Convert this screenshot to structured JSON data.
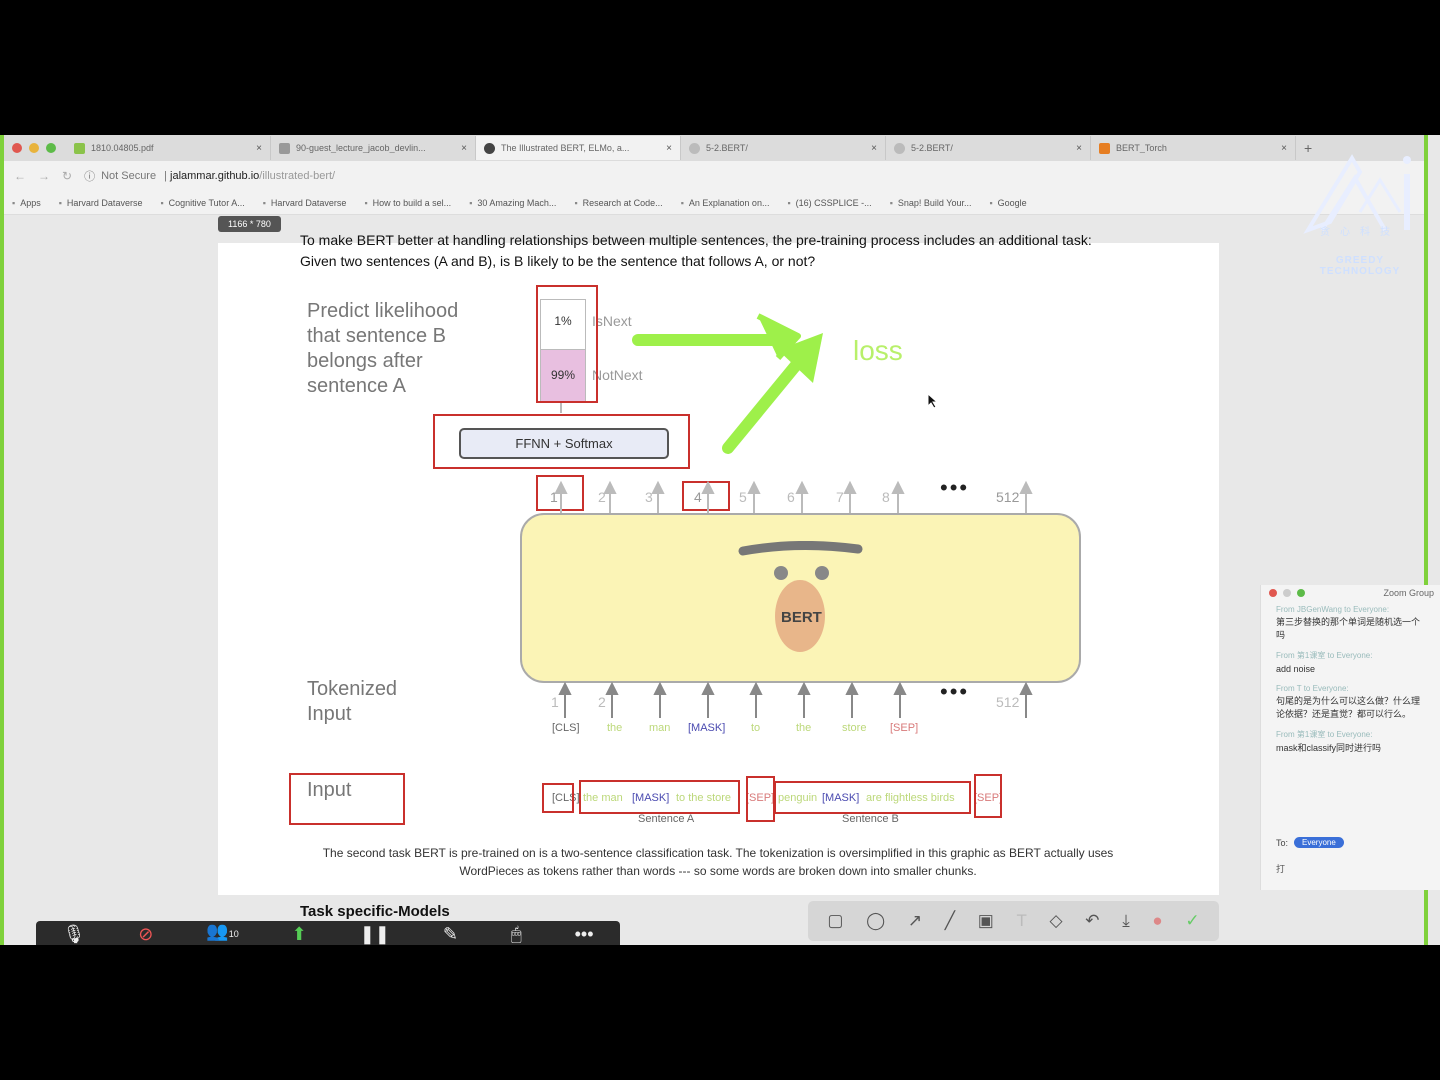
{
  "browser": {
    "tabs": [
      {
        "label": "1810.04805.pdf",
        "active": false
      },
      {
        "label": "90-guest_lecture_jacob_devlin...",
        "active": false
      },
      {
        "label": "The Illustrated BERT, ELMo, a...",
        "active": true
      },
      {
        "label": "5-2.BERT/",
        "active": false
      },
      {
        "label": "5-2.BERT/",
        "active": false
      },
      {
        "label": "BERT_Torch",
        "active": false
      }
    ],
    "security": "Not Secure",
    "url_domain": "jalammar.github.io",
    "url_path": "/illustrated-bert/",
    "bookmarks": [
      "Apps",
      "Harvard Dataverse",
      "Cognitive Tutor A...",
      "Harvard Dataverse",
      "How to build a sel...",
      "30 Amazing Mach...",
      "Research at Code...",
      "An Explanation on...",
      "(16) CSSPLICE -...",
      "Snap! Build Your...",
      "Google"
    ],
    "size_badge": "1166 * 780"
  },
  "page": {
    "intro_text": "To make BERT better at handling relationships between multiple sentences, the pre-training process includes an additional task: Given two sentences (A and B), is B likely to be the sentence that follows A, or not?",
    "predict_label": [
      "Predict likelihood",
      "that sentence B",
      "belongs after",
      "sentence A"
    ],
    "prob_isnext": "1%",
    "label_isnext": "IsNext",
    "prob_notnext": "99%",
    "label_notnext": "NotNext",
    "ffnn_label": "FFNN + Softmax",
    "loss_label": "loss",
    "bert_label": "BERT",
    "output_positions": [
      "1",
      "2",
      "3",
      "4",
      "5",
      "6",
      "7",
      "8",
      "512"
    ],
    "input_positions": [
      "1",
      "2",
      "512"
    ],
    "ellipsis": "•••",
    "tokenized_label": [
      "Tokenized",
      "Input"
    ],
    "tokens": [
      "[CLS]",
      "the",
      "man",
      "[MASK]",
      "to",
      "the",
      "store",
      "[SEP]"
    ],
    "input_label": "Input",
    "input_tokens": {
      "cls": "[CLS]",
      "sentence_a_pre": "the man",
      "sentence_a_mask": "[MASK]",
      "sentence_a_post": "to the store",
      "sep1": "[SEP]",
      "sentence_b_pre": "penguin",
      "sentence_b_mask": "[MASK]",
      "sentence_b_post": "are flightless birds",
      "sep2": "[SEP]"
    },
    "sentence_a_caption": "Sentence A",
    "sentence_b_caption": "Sentence B",
    "caption": "The second task BERT is pre-trained on is a two-sentence classification task. The tokenization is oversimplified in this graphic as BERT actually uses WordPieces as tokens rather than words --- so some words are broken down into smaller chunks.",
    "next_heading": "Task specific-Models"
  },
  "zoom": {
    "participants_count": "10",
    "chat_title": "Zoom Group",
    "messages": [
      {
        "from": "From JBGenWang to Everyone:",
        "body": "第三步替换的那个单词是随机选一个吗"
      },
      {
        "from": "From 第1课室 to Everyone:",
        "body": "add noise"
      },
      {
        "from": "From T to Everyone:",
        "body": "句尾的是为什么可以这么做？什么理论依据？还是直觉？都可以行么。"
      },
      {
        "from": "From 第1课室 to Everyone:",
        "body": "mask和classify同时进行吗"
      }
    ],
    "to_label": "To:",
    "to_value": "Everyone",
    "typed": "打"
  },
  "logo": {
    "cn": "贪心科技",
    "en": "GREEDY TECHNOLOGY"
  },
  "colors": {
    "accent_green": "#7fd13b",
    "loss_green": "#b8f06a",
    "red_box": "#c9302c"
  }
}
